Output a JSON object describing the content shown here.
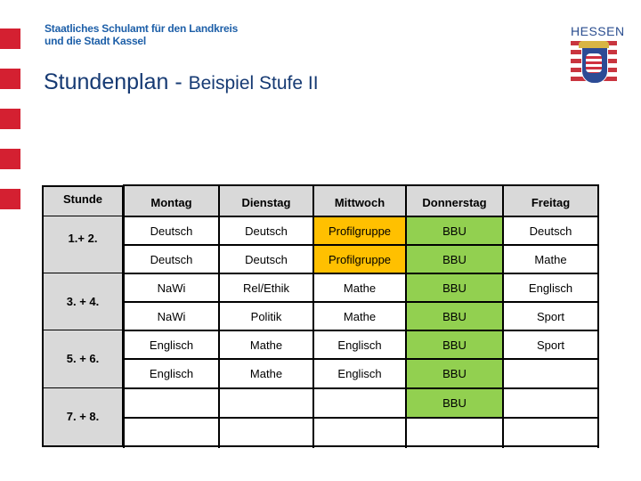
{
  "header": {
    "organization_line1": "Staatliches Schulamt für den Landkreis",
    "organization_line2": "und die Stadt Kassel",
    "title_main": "Stundenplan - ",
    "title_sub": "Beispiel Stufe II",
    "logo_text": "HESSEN"
  },
  "colors": {
    "accent_red": "#d42031",
    "profil_orange": "#ffc000",
    "bbu_green": "#92d050",
    "header_gray": "#d9d9d9",
    "title_blue": "#163a73"
  },
  "timetable": {
    "stunde_header": "Stunde",
    "days": [
      "Montag",
      "Dienstag",
      "Mittwoch",
      "Donnerstag",
      "Freitag"
    ],
    "periods": [
      "1.+ 2.",
      "3. + 4.",
      "5. + 6.",
      "7. + 8."
    ],
    "rows": [
      [
        "Deutsch",
        "Deutsch",
        "Profilgruppe",
        "BBU",
        "Deutsch"
      ],
      [
        "Deutsch",
        "Deutsch",
        "Profilgruppe",
        "BBU",
        "Mathe"
      ],
      [
        "NaWi",
        "Rel/Ethik",
        "Mathe",
        "BBU",
        "Englisch"
      ],
      [
        "NaWi",
        "Politik",
        "Mathe",
        "BBU",
        "Sport"
      ],
      [
        "Englisch",
        "Mathe",
        "Englisch",
        "BBU",
        "Sport"
      ],
      [
        "Englisch",
        "Mathe",
        "Englisch",
        "BBU",
        ""
      ],
      [
        "",
        "",
        "",
        "BBU",
        ""
      ],
      [
        "",
        "",
        "",
        "",
        ""
      ]
    ],
    "highlights": {
      "Profilgruppe": "orange",
      "BBU": "green"
    }
  }
}
